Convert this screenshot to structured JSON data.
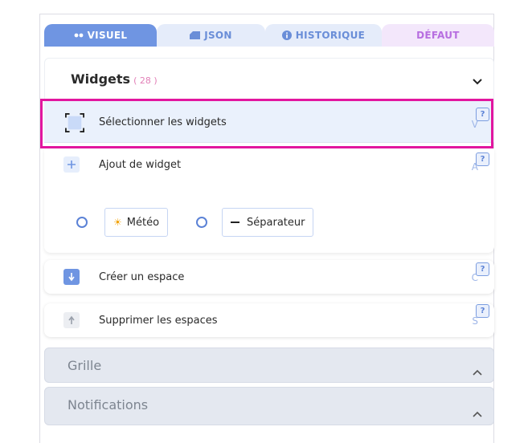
{
  "tabs": [
    {
      "label": "VISUEL",
      "icon": "visual-icon"
    },
    {
      "label": "JSON",
      "icon": "json-icon"
    },
    {
      "label": "HISTORIQUE",
      "icon": "info-icon"
    },
    {
      "label": "DÉFAUT"
    }
  ],
  "panel": {
    "title": "Widgets",
    "count": "( 28 )"
  },
  "rows": {
    "select": {
      "label": "Sélectionner les widgets",
      "key": "V",
      "help": "?"
    },
    "add": {
      "label": "Ajout de widget",
      "key": "A",
      "help": "?"
    },
    "create": {
      "label": "Créer un espace",
      "key": "C",
      "help": "?"
    },
    "delete": {
      "label": "Supprimer les espaces",
      "key": "S",
      "help": "?"
    }
  },
  "widget_options": [
    {
      "label": "Météo",
      "icon": "sun-icon"
    },
    {
      "label": "Séparateur",
      "icon": "dash-icon"
    }
  ],
  "sections": {
    "grid": "Grille",
    "notifications": "Notifications"
  },
  "colors": {
    "accent": "#6f95e2",
    "highlight": "#e2169f",
    "defaut": "#b76ee0"
  }
}
